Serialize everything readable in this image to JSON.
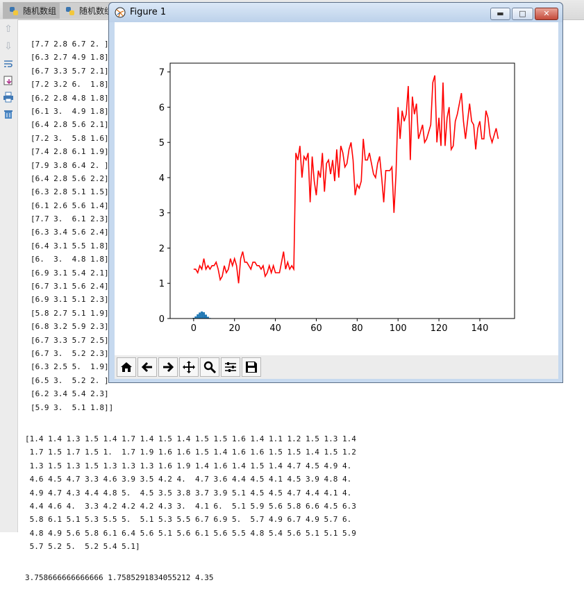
{
  "tabs": [
    {
      "label": "随机数组",
      "active": true
    },
    {
      "label": "随机数组",
      "active": false
    }
  ],
  "gutter_icons": [
    "up-arrow-icon",
    "down-arrow-icon",
    "soft-wrap-icon",
    "scroll-to-end-icon",
    "print-icon",
    "trash-icon"
  ],
  "console": {
    "lines": [
      "[7.7 2.8 6.7 2. ]",
      "[6.3 2.7 4.9 1.8]",
      "[6.7 3.3 5.7 2.1]",
      "[7.2 3.2 6.  1.8]",
      "[6.2 2.8 4.8 1.8]",
      "[6.1 3.  4.9 1.8]",
      "[6.4 2.8 5.6 2.1]",
      "[7.2 3.  5.8 1.6]",
      "[7.4 2.8 6.1 1.9]",
      "[7.9 3.8 6.4 2. ]",
      "[6.4 2.8 5.6 2.2]",
      "[6.3 2.8 5.1 1.5]",
      "[6.1 2.6 5.6 1.4]",
      "[7.7 3.  6.1 2.3]",
      "[6.3 3.4 5.6 2.4]",
      "[6.4 3.1 5.5 1.8]",
      "[6.  3.  4.8 1.8]",
      "[6.9 3.1 5.4 2.1]",
      "[6.7 3.1 5.6 2.4]",
      "[6.9 3.1 5.1 2.3]",
      "[5.8 2.7 5.1 1.9]",
      "[6.8 3.2 5.9 2.3]",
      "[6.7 3.3 5.7 2.5]",
      "[6.7 3.  5.2 2.3]",
      "[6.3 2.5 5.  1.9]",
      "[6.5 3.  5.2 2. ]",
      "[6.2 3.4 5.4 2.3]",
      "[5.9 3.  5.1 1.8]]"
    ],
    "array_lines": [
      "[1.4 1.4 1.3 1.5 1.4 1.7 1.4 1.5 1.4 1.5 1.5 1.6 1.4 1.1 1.2 1.5 1.3 1.4",
      " 1.7 1.5 1.7 1.5 1.  1.7 1.9 1.6 1.6 1.5 1.4 1.6 1.6 1.5 1.5 1.4 1.5 1.2",
      " 1.3 1.5 1.3 1.5 1.3 1.3 1.3 1.6 1.9 1.4 1.6 1.4 1.5 1.4 4.7 4.5 4.9 4.",
      " 4.6 4.5 4.7 3.3 4.6 3.9 3.5 4.2 4.  4.7 3.6 4.4 4.5 4.1 4.5 3.9 4.8 4.",
      " 4.9 4.7 4.3 4.4 4.8 5.  4.5 3.5 3.8 3.7 3.9 5.1 4.5 4.5 4.7 4.4 4.1 4.",
      " 4.4 4.6 4.  3.3 4.2 4.2 4.2 4.3 3.  4.1 6.  5.1 5.9 5.6 5.8 6.6 4.5 6.3",
      " 5.8 6.1 5.1 5.3 5.5 5.  5.1 5.3 5.5 6.7 6.9 5.  5.7 4.9 6.7 4.9 5.7 6.",
      " 4.8 4.9 5.6 5.8 6.1 6.4 5.6 5.1 5.6 6.1 5.6 5.5 4.8 5.4 5.6 5.1 5.1 5.9",
      " 5.7 5.2 5.  5.2 5.4 5.1]"
    ],
    "stats_line": "3.758666666666666 1.7585291834055212 4.35"
  },
  "figure": {
    "title": "Figure 1",
    "window_buttons": [
      "minimize-button",
      "maximize-button",
      "close-button"
    ],
    "toolbar": [
      "home-button",
      "back-button",
      "forward-button",
      "pan-button",
      "zoom-button",
      "configure-subplots-button",
      "save-button"
    ]
  },
  "chart_data": {
    "type": "line",
    "xlim": [
      -11.5,
      157
    ],
    "ylim": [
      0,
      7.25
    ],
    "xticks": [
      "0",
      "20",
      "40",
      "60",
      "80",
      "100",
      "120",
      "140"
    ],
    "yticks": [
      "0",
      "1",
      "2",
      "3",
      "4",
      "5",
      "6",
      "7"
    ],
    "grid": false,
    "line_color": "#ff0000",
    "y": [
      1.4,
      1.4,
      1.3,
      1.5,
      1.4,
      1.7,
      1.4,
      1.5,
      1.4,
      1.5,
      1.5,
      1.6,
      1.4,
      1.1,
      1.2,
      1.5,
      1.3,
      1.4,
      1.7,
      1.5,
      1.7,
      1.5,
      1.0,
      1.7,
      1.9,
      1.6,
      1.6,
      1.5,
      1.4,
      1.6,
      1.6,
      1.5,
      1.5,
      1.4,
      1.5,
      1.2,
      1.3,
      1.5,
      1.3,
      1.5,
      1.3,
      1.3,
      1.3,
      1.6,
      1.9,
      1.4,
      1.6,
      1.4,
      1.5,
      1.4,
      4.7,
      4.5,
      4.9,
      4.0,
      4.6,
      4.5,
      4.7,
      3.3,
      4.6,
      3.9,
      3.5,
      4.2,
      4.0,
      4.7,
      3.6,
      4.4,
      4.5,
      4.1,
      4.5,
      3.9,
      4.8,
      4.0,
      4.9,
      4.7,
      4.3,
      4.4,
      4.8,
      5.0,
      4.5,
      3.5,
      3.8,
      3.7,
      3.9,
      5.1,
      4.5,
      4.5,
      4.7,
      4.4,
      4.1,
      4.0,
      4.4,
      4.6,
      4.0,
      3.3,
      4.2,
      4.2,
      4.2,
      4.3,
      3.0,
      4.1,
      6.0,
      5.1,
      5.9,
      5.6,
      5.8,
      6.6,
      4.5,
      6.3,
      5.8,
      6.1,
      5.1,
      5.3,
      5.5,
      5.0,
      5.1,
      5.3,
      5.5,
      6.7,
      6.9,
      5.0,
      5.7,
      4.9,
      6.7,
      4.9,
      5.7,
      6.0,
      4.8,
      4.9,
      5.6,
      5.8,
      6.1,
      6.4,
      5.6,
      5.1,
      5.6,
      6.1,
      5.6,
      5.5,
      4.8,
      5.4,
      5.6,
      5.1,
      5.1,
      5.9,
      5.7,
      5.2,
      5.0,
      5.2,
      5.4,
      5.1
    ],
    "hist_color": "#1f77b4",
    "hist": {
      "x": [
        -1,
        0,
        1,
        2,
        3,
        4,
        5,
        6,
        7,
        8
      ],
      "values": [
        0.005,
        0.02,
        0.06,
        0.12,
        0.17,
        0.2,
        0.18,
        0.11,
        0.05,
        0.015
      ]
    }
  }
}
